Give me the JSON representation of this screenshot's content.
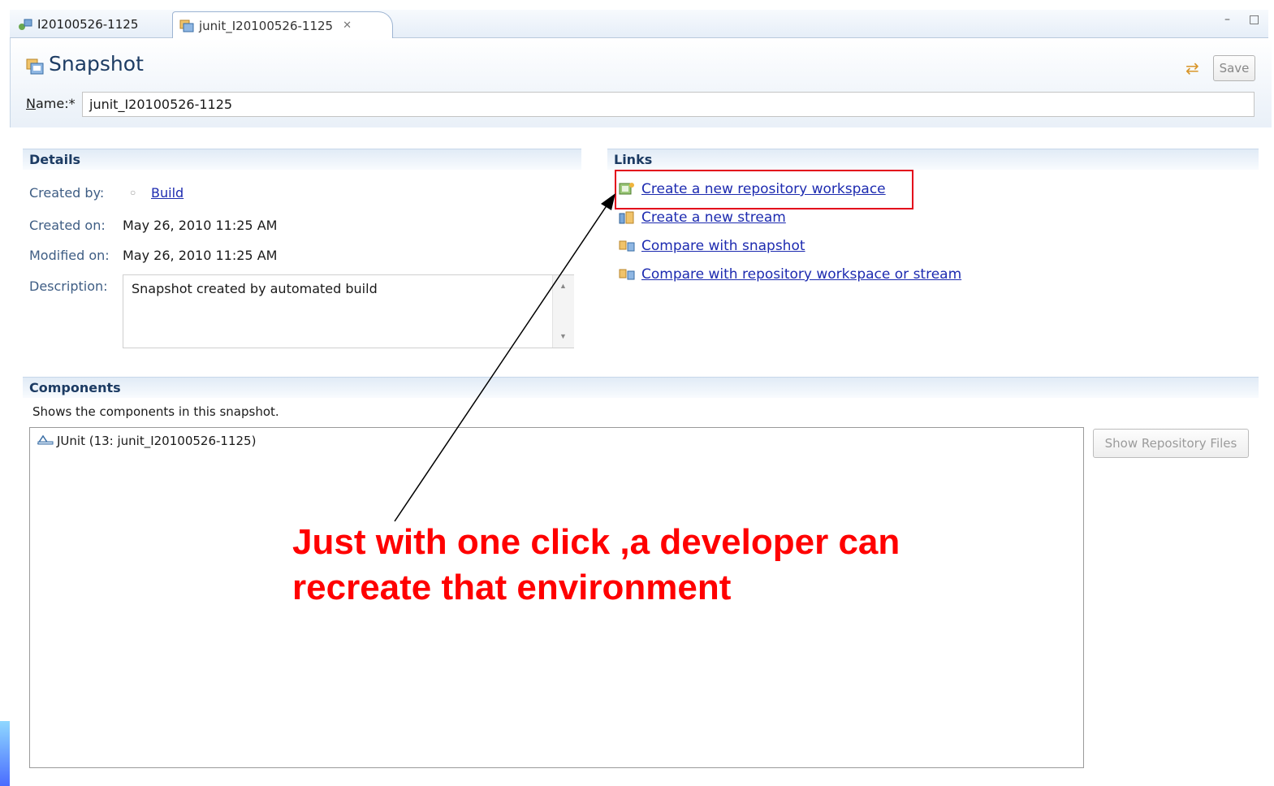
{
  "tabs": [
    {
      "label": "I20100526-1125",
      "active": false
    },
    {
      "label": "junit_I20100526-1125",
      "active": true
    }
  ],
  "window_controls": {
    "minimize": "–",
    "maximize": "□"
  },
  "header": {
    "title": "Snapshot",
    "save_label": "Save"
  },
  "name": {
    "label_underlined": "N",
    "label_rest": "ame:*",
    "value": "junit_I20100526-1125"
  },
  "details": {
    "title": "Details",
    "created_by_label": "Created by:",
    "created_by_value": "Build",
    "created_on_label": "Created on:",
    "created_on_value": "May 26, 2010 11:25 AM",
    "modified_on_label": "Modified on:",
    "modified_on_value": "May 26, 2010 11:25 AM",
    "description_label": "Description:",
    "description_value": "Snapshot created by automated build"
  },
  "links": {
    "title": "Links",
    "items": [
      {
        "label": "Create a new repository workspace",
        "icon": "workspace-icon"
      },
      {
        "label": "Create a new stream",
        "icon": "stream-icon"
      },
      {
        "label": "Compare with snapshot",
        "icon": "compare-icon"
      },
      {
        "label": "Compare with repository workspace or stream",
        "icon": "compare-icon"
      }
    ]
  },
  "components": {
    "title": "Components",
    "description": "Shows the components in this snapshot.",
    "items": [
      "JUnit (13: junit_I20100526-1125)"
    ],
    "show_files_button": "Show Repository Files"
  },
  "annotation": {
    "line1": "Just with one click ,a developer can",
    "line2": "recreate that environment",
    "color": "#ff0000"
  },
  "colors": {
    "accent": "#1d3c64",
    "link": "#1d2bb0",
    "highlight": "#e3001b"
  }
}
